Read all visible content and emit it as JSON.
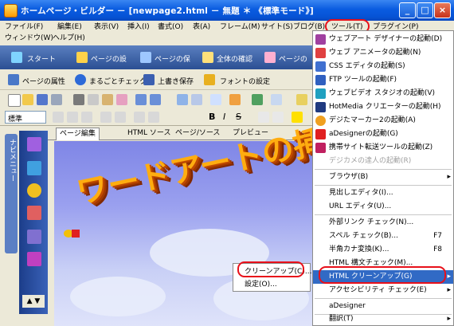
{
  "window": {
    "title": "ホームページ・ビルダー － [newpage2.html － 無題 ＊ 《標準モード》]",
    "minimize": "_",
    "maximize": "□",
    "close": "×"
  },
  "menubar": {
    "row1": [
      "ファイル(F)",
      "編集(E)",
      "表示(V)",
      "挿入(I)",
      "書式(O)",
      "表(A)",
      "フレーム(M)",
      "サイト(S)",
      "ブログ(B)",
      "ツール(T)",
      "プラグイン(P)"
    ],
    "row2": [
      "ウィンドウ(W)",
      "ヘルプ(H)"
    ]
  },
  "toolbar_big1": [
    "スタート",
    "ページの設",
    "ページの保",
    "全体の確認",
    "ページの"
  ],
  "toolbar_big2": [
    "ページの属性",
    "まるごとチェック",
    "上書き保存",
    "フォントの設定"
  ],
  "format_bar": {
    "style": "標準"
  },
  "left_nav": {
    "label": "ナビメニュー"
  },
  "tabs": [
    "ページ編集",
    "HTML ソース",
    "ページ/ソース",
    "プレビュー"
  ],
  "editor": {
    "wordart": "ワードアートの挿入"
  },
  "tools_menu": {
    "items": [
      {
        "label": "ウェブアート デザイナーの起動(D)",
        "icon": "webart-icon",
        "shortcut": "",
        "arrow": false,
        "disabled": false
      },
      {
        "label": "ウェブ アニメータの起動(N)",
        "icon": "animator-icon",
        "shortcut": "",
        "arrow": false,
        "disabled": false
      },
      {
        "label": "CSS エディタの起動(S)",
        "icon": "css-icon",
        "shortcut": "",
        "arrow": false,
        "disabled": false
      },
      {
        "label": "FTP ツールの起動(F)",
        "icon": "ftp-icon",
        "shortcut": "",
        "arrow": false,
        "disabled": false
      },
      {
        "label": "ウェブビデオ スタジオの起動(V)",
        "icon": "video-icon",
        "shortcut": "",
        "arrow": false,
        "disabled": false
      },
      {
        "label": "HotMedia クリエーターの起動(H)",
        "icon": "hotmedia-icon",
        "shortcut": "",
        "arrow": false,
        "disabled": false
      },
      {
        "label": "デジたマーカー2の起動(A)",
        "icon": "marker-icon",
        "shortcut": "",
        "arrow": false,
        "disabled": false
      },
      {
        "label": "aDesignerの起動(G)",
        "icon": "adesigner-icon",
        "shortcut": "",
        "arrow": false,
        "disabled": false
      },
      {
        "label": "携帯サイト転送ツールの起動(Z)",
        "icon": "mobile-icon",
        "shortcut": "",
        "arrow": false,
        "disabled": false
      },
      {
        "label": "デジカメの達人の起動(R)",
        "icon": "",
        "shortcut": "",
        "arrow": false,
        "disabled": true
      },
      {
        "label": "ブラウザ(B)",
        "icon": "",
        "shortcut": "",
        "arrow": true,
        "disabled": false
      },
      {
        "label": "見出しエディタ(I)...",
        "icon": "",
        "shortcut": "",
        "arrow": false,
        "disabled": false
      },
      {
        "label": "URL エディタ(U)...",
        "icon": "",
        "shortcut": "",
        "arrow": false,
        "disabled": false
      },
      {
        "label": "外部リンク チェック(N)...",
        "icon": "",
        "shortcut": "",
        "arrow": false,
        "disabled": false
      },
      {
        "label": "スペル チェック(B)...",
        "icon": "",
        "shortcut": "F7",
        "arrow": false,
        "disabled": false
      },
      {
        "label": "半角カナ変換(K)...",
        "icon": "",
        "shortcut": "F8",
        "arrow": false,
        "disabled": false
      },
      {
        "label": "HTML 構文チェック(M)...",
        "icon": "",
        "shortcut": "",
        "arrow": false,
        "disabled": false
      },
      {
        "label": "HTML クリーンアップ(G)",
        "icon": "",
        "shortcut": "",
        "arrow": true,
        "disabled": false
      },
      {
        "label": "アクセシビリティ チェック(E)",
        "icon": "",
        "shortcut": "",
        "arrow": true,
        "disabled": false
      },
      {
        "label": "aDesigner",
        "icon": "",
        "shortcut": "",
        "arrow": false,
        "disabled": false
      },
      {
        "label": "翻訳(T)",
        "icon": "",
        "shortcut": "",
        "arrow": true,
        "disabled": false
      }
    ]
  },
  "cleanup_submenu": [
    "クリーンアップ(C)...",
    "設定(O)..."
  ],
  "colors": {
    "titlebar": "#0a5ce0",
    "highlight": "#316ac5",
    "annotation": "#e8101a"
  }
}
